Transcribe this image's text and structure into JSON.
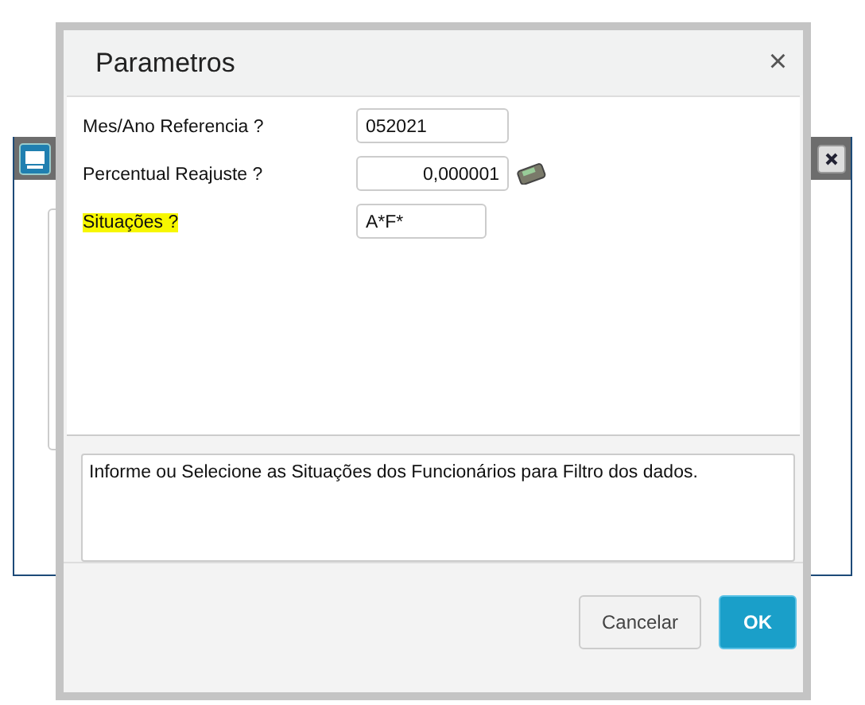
{
  "dialog": {
    "title": "Parametros",
    "close": "×"
  },
  "fields": [
    {
      "label": "Mes/Ano Referencia ?",
      "value": "052021",
      "kind": "text",
      "calculator": false,
      "highlighted": false
    },
    {
      "label": "Percentual Reajuste ?",
      "value": "0,000001",
      "kind": "numeric",
      "calculator": true,
      "highlighted": false
    },
    {
      "label": "Situações ?",
      "value": "A*F*",
      "kind": "text",
      "calculator": false,
      "highlighted": true
    }
  ],
  "help_text": "Informe ou Selecione as Situações dos Funcionários para Filtro dos dados.",
  "buttons": [
    {
      "label": "Cancelar",
      "kind": "secondary"
    },
    {
      "label": "OK",
      "kind": "primary"
    }
  ]
}
